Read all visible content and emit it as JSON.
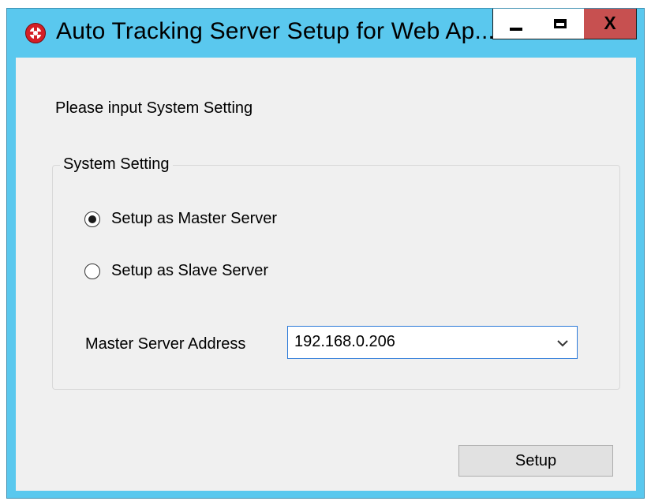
{
  "window": {
    "title": "Auto Tracking Server Setup for Web Ap...",
    "icon": "red-crosshair-gear-icon",
    "controls": {
      "minimize": "minimize-icon",
      "maximize": "maximize-icon",
      "close_label": "X"
    },
    "colors": {
      "frame": "#5ac8ee",
      "close": "#c75050",
      "client": "#f0f0f0"
    }
  },
  "content": {
    "prompt": "Please input System Setting",
    "group": {
      "legend": "System Setting",
      "options": [
        {
          "label": "Setup as Master Server",
          "checked": true
        },
        {
          "label": "Setup as Slave Server",
          "checked": false
        }
      ],
      "master_address": {
        "label": "Master Server Address",
        "value": "192.168.0.206"
      }
    },
    "setup_button": "Setup"
  }
}
